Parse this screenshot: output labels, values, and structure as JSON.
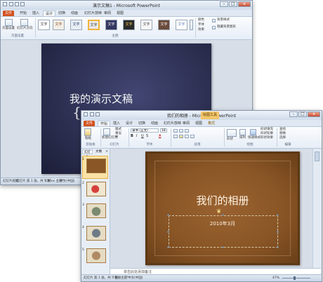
{
  "back": {
    "title": "演示文稿1 - Microsoft PowerPoint",
    "tabs": [
      "文件",
      "开始",
      "插入",
      "设计",
      "切换",
      "动画",
      "幻灯片放映",
      "审阅",
      "视图"
    ],
    "active_tab": "设计",
    "page_setup_label": "页面设置",
    "slide_direction_label": "幻灯片方向",
    "page_setup_group": "页面设置",
    "themes_group": "主题",
    "theme_text": "文字",
    "colors": "颜色",
    "fonts": "字体",
    "effects": "效果",
    "background_styles": "背景样式",
    "hide_bg": "隐藏背景图形",
    "slide_title": "我的演示文稿",
    "status_view": "幻灯片视图",
    "status_slide": "幻灯片 第 1 张，共 1 张",
    "status_theme": "\"Office 主题\"",
    "status_lang": "中文(中国)"
  },
  "front": {
    "title": "我们的相册 - Microsoft PowerPoint",
    "tool_tab": "绘图工具",
    "tabs": [
      "文件",
      "开始",
      "插入",
      "设计",
      "切换",
      "动画",
      "幻灯片放映",
      "审阅",
      "视图",
      "格式"
    ],
    "active_tab": "开始",
    "paste": "粘贴",
    "new_slide": "新建幻灯片",
    "layout": "版式",
    "reset": "重设",
    "section": "节",
    "font_name": "隶书 (正文)",
    "font_size": "18",
    "groups": {
      "clipboard": "剪贴板",
      "slides": "幻灯片",
      "font": "字体",
      "paragraph": "段落",
      "drawing": "绘图",
      "editing": "编辑"
    },
    "shape_fill": "形状填充",
    "shape_outline": "形状轮廓",
    "shape_effects": "形状效果",
    "find": "查找",
    "replace": "替换",
    "select": "选择",
    "arrange": "排列",
    "quick_styles": "快速样式",
    "shapes": "形状",
    "panel_tabs": [
      "幻灯片",
      "大纲"
    ],
    "slide_numbers": [
      "1",
      "2",
      "3",
      "4",
      "5"
    ],
    "slide_title": "我们的相册",
    "slide_date": "2010年3月",
    "notes_placeholder": "单击此处添加备注",
    "status_slide": "幻灯片 第 1 张，共 5 张",
    "status_theme": "\"相册主题\"",
    "status_lang": "中文(中国)",
    "zoom": "47%"
  },
  "colors": {
    "file_tab": "#d3511e",
    "back_slide": "#2d3052",
    "front_slide": "#8a5626"
  }
}
